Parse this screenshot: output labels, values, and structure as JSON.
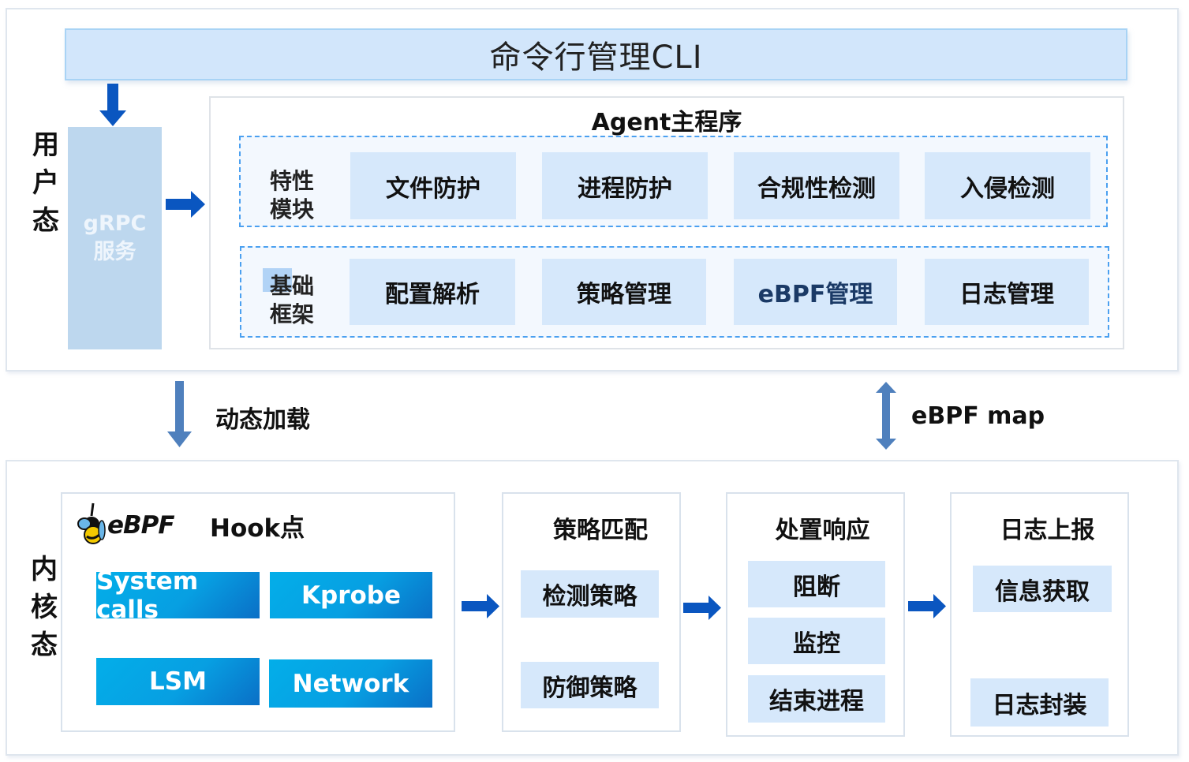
{
  "cli": {
    "label": "命令行管理CLI"
  },
  "user_space": {
    "label_chars": [
      "用",
      "户",
      "态"
    ],
    "grpc": {
      "line1": "gRPC",
      "line2": "服务"
    },
    "agent": {
      "title": "Agent主程序",
      "feature_row": {
        "label_line1": "特性",
        "label_line2": "模块",
        "modules": [
          "文件防护",
          "进程防护",
          "合规性检测",
          "入侵检测"
        ]
      },
      "base_row": {
        "label_line1": "基础",
        "label_line2": "框架",
        "modules": [
          "配置解析",
          "策略管理",
          "eBPF管理",
          "日志管理"
        ]
      }
    }
  },
  "transitions": {
    "load": "动态加载",
    "map": "eBPF map"
  },
  "kernel_space": {
    "label_chars": [
      "内",
      "核",
      "态"
    ],
    "hook": {
      "logo_text": "eBPF",
      "title": "Hook点",
      "items": [
        "System calls",
        "Kprobe",
        "LSM",
        "Network"
      ]
    },
    "policy_match": {
      "title": "策略匹配",
      "items": [
        "检测策略",
        "防御策略"
      ]
    },
    "response": {
      "title": "处置响应",
      "items": [
        "阻断",
        "监控",
        "结束进程"
      ]
    },
    "log_report": {
      "title": "日志上报",
      "items": [
        "信息获取",
        "日志封装"
      ]
    }
  },
  "colors": {
    "arrow_dark": "#0a56c0",
    "arrow_light": "#4f80bd",
    "module_fill": "#d6e8fb",
    "dash_border": "#4ba0f0",
    "hook_gradient_start": "#03aee9",
    "hook_gradient_end": "#0a6fc6"
  }
}
